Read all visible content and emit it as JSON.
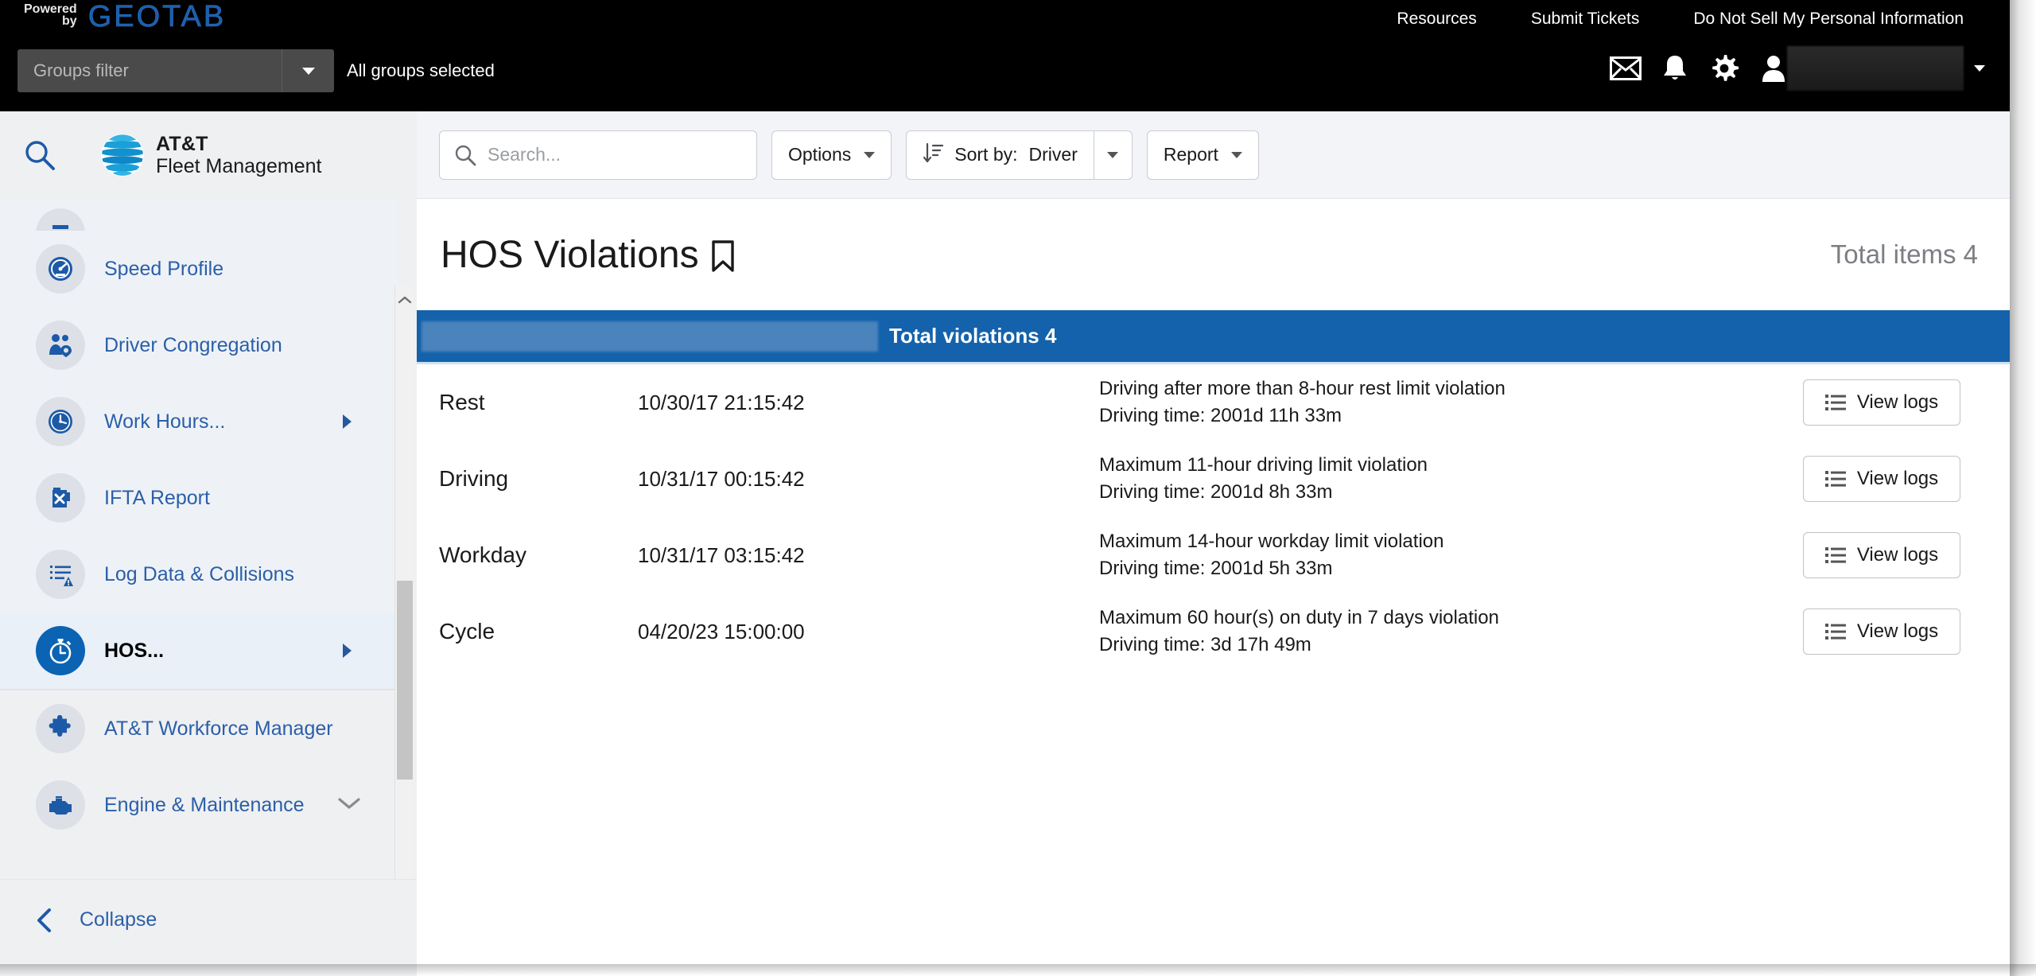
{
  "brand": {
    "powered_line1": "Powered",
    "powered_line2": "by",
    "geotab": "GEOTAB",
    "app_name_line1": "AT&T",
    "app_name_line2": "Fleet Management",
    "accent_blue": "#1462ac",
    "geotab_blue": "#1b5fae"
  },
  "topbar": {
    "groups_filter_placeholder": "Groups filter",
    "all_groups_selected": "All groups selected",
    "links": [
      {
        "label": "Resources"
      },
      {
        "label": "Submit Tickets"
      },
      {
        "label": "Do Not Sell My Personal Information"
      }
    ],
    "icons": [
      {
        "name": "mail-icon"
      },
      {
        "name": "bell-icon"
      },
      {
        "name": "gear-icon"
      },
      {
        "name": "user-icon"
      }
    ],
    "username_redacted": ""
  },
  "sidebar": {
    "search_icon": "search-icon",
    "items": [
      {
        "label": "Speed Profile",
        "icon": "speedometer-icon",
        "has_submenu": false,
        "selected": false
      },
      {
        "label": "Driver Congregation",
        "icon": "people-location-icon",
        "has_submenu": false,
        "selected": false
      },
      {
        "label": "Work Hours...",
        "icon": "clock-icon",
        "has_submenu": true,
        "selected": false
      },
      {
        "label": "IFTA Report",
        "icon": "fuel-can-icon",
        "has_submenu": false,
        "selected": false
      },
      {
        "label": "Log Data & Collisions",
        "icon": "log-alert-icon",
        "has_submenu": false,
        "selected": false
      },
      {
        "label": "HOS...",
        "icon": "stopwatch-icon",
        "has_submenu": true,
        "selected": true
      }
    ],
    "extra_items": [
      {
        "label": "AT&T Workforce Manager",
        "icon": "puzzle-icon",
        "chevron": "none"
      },
      {
        "label": "Engine & Maintenance",
        "icon": "engine-icon",
        "chevron": "down"
      }
    ],
    "collapse_label": "Collapse",
    "collapse_icon": "chevron-left-icon"
  },
  "toolbar": {
    "search_placeholder": "Search...",
    "search_value": "",
    "options_label": "Options",
    "sort_by_label": "Sort by:",
    "sort_by_value": "Driver",
    "report_label": "Report"
  },
  "page": {
    "title": "HOS Violations",
    "bookmark_icon": "bookmark-icon",
    "total_items": "Total items 4"
  },
  "group_header": {
    "driver_name_redacted": "",
    "total_violations": "Total violations 4"
  },
  "table": {
    "view_logs_label": "View logs",
    "rows": [
      {
        "type": "Rest",
        "datetime": "10/30/17 21:15:42",
        "description": "Driving after more than 8-hour rest limit violation",
        "driving_time": "Driving time: 2001d 11h 33m"
      },
      {
        "type": "Driving",
        "datetime": "10/31/17 00:15:42",
        "description": "Maximum 11-hour driving limit violation",
        "driving_time": "Driving time: 2001d 8h 33m"
      },
      {
        "type": "Workday",
        "datetime": "10/31/17 03:15:42",
        "description": "Maximum 14-hour workday limit violation",
        "driving_time": "Driving time: 2001d 5h 33m"
      },
      {
        "type": "Cycle",
        "datetime": "04/20/23 15:00:00",
        "description": "Maximum 60 hour(s) on duty in 7 days violation",
        "driving_time": "Driving time: 3d 17h 49m"
      }
    ]
  }
}
